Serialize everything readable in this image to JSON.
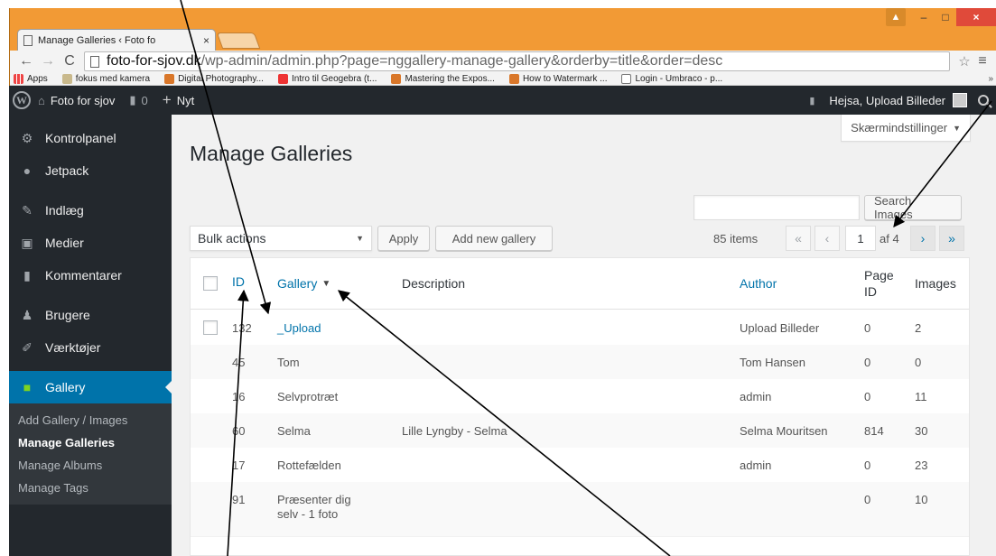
{
  "browser": {
    "tab_title": "Manage Galleries ‹ Foto fo",
    "tab_close": "×",
    "url_domain": "foto-for-sjov.dk",
    "url_path": "/wp-admin/admin.php?page=nggallery-manage-gallery&orderby=title&order=desc",
    "nav": {
      "back": "←",
      "forward": "→",
      "reload": "C"
    },
    "star": "☆",
    "menu": "≡",
    "window_controls": {
      "user": "▲",
      "minimize": "–",
      "maximize": "□",
      "close": "×"
    },
    "bookmarks": [
      {
        "label": "Apps",
        "icon": "apps-icon"
      },
      {
        "label": "fokus med kamera",
        "icon": "folder-icon"
      },
      {
        "label": "Digital Photography...",
        "icon": "dps-icon"
      },
      {
        "label": "Intro til Geogebra (t...",
        "icon": "youtube-icon"
      },
      {
        "label": "Mastering the Expos...",
        "icon": "dps-icon"
      },
      {
        "label": "How to Watermark ...",
        "icon": "dps-icon"
      },
      {
        "label": "Login - Umbraco - p...",
        "icon": "page-icon"
      }
    ],
    "bookmarks_more": "»"
  },
  "adminbar": {
    "wp_logo": "W",
    "site_icon": "⌂",
    "site_name": "Foto for sjov",
    "comments_icon": "▮",
    "comments_count": "0",
    "new_icon": "+",
    "new_label": "Nyt",
    "howdy": "Hejsa, Upload Billeder"
  },
  "sidebar": {
    "items": [
      {
        "label": "Kontrolpanel",
        "icon": "⚙"
      },
      {
        "label": "Jetpack",
        "icon": "●"
      },
      {
        "label": "Indlæg",
        "icon": "✎"
      },
      {
        "label": "Medier",
        "icon": "▣"
      },
      {
        "label": "Kommentarer",
        "icon": "▮"
      },
      {
        "label": "Brugere",
        "icon": "♟"
      },
      {
        "label": "Værktøjer",
        "icon": "✐"
      },
      {
        "label": "Gallery",
        "icon": "■"
      }
    ],
    "submenu": [
      "Add Gallery / Images",
      "Manage Galleries",
      "Manage Albums",
      "Manage Tags"
    ]
  },
  "content": {
    "screen_options": "Skærmindstillinger",
    "screen_options_arrow": "▼",
    "title": "Manage Galleries",
    "search_button": "Search Images",
    "search_value": "",
    "bulk_actions": "Bulk actions",
    "bulk_caret": "▼",
    "apply": "Apply",
    "add_new_gallery": "Add new gallery",
    "items_count": "85 items",
    "pager": {
      "first": "«",
      "prev": "‹",
      "current": "1",
      "total": "af 4",
      "next": "›",
      "last": "»"
    }
  },
  "table": {
    "headers": {
      "id": "ID",
      "gallery": "Gallery",
      "gallery_sort": "▼",
      "description": "Description",
      "author": "Author",
      "page_id_line1": "Page",
      "page_id_line2": "ID",
      "images": "Images"
    },
    "rows": [
      {
        "id": "132",
        "gallery": "_Upload",
        "gallery_line2": "",
        "description": "",
        "author": "Upload Billeder",
        "page_id": "0",
        "images": "2"
      },
      {
        "id": "45",
        "gallery": "Tom",
        "gallery_line2": "",
        "description": "",
        "author": "Tom Hansen",
        "page_id": "0",
        "images": "0"
      },
      {
        "id": "16",
        "gallery": "Selvprotræt",
        "gallery_line2": "",
        "description": "",
        "author": "admin",
        "page_id": "0",
        "images": "11"
      },
      {
        "id": "60",
        "gallery": "Selma",
        "gallery_line2": "",
        "description": "Lille Lyngby - Selma",
        "author": "Selma Mouritsen",
        "page_id": "814",
        "images": "30"
      },
      {
        "id": "17",
        "gallery": "Rottefælden",
        "gallery_line2": "",
        "description": "",
        "author": "admin",
        "page_id": "0",
        "images": "23"
      },
      {
        "id": "91",
        "gallery": "Præsenter dig",
        "gallery_line2": "selv - 1 foto",
        "description": "",
        "author": "",
        "page_id": "0",
        "images": "10"
      }
    ]
  }
}
